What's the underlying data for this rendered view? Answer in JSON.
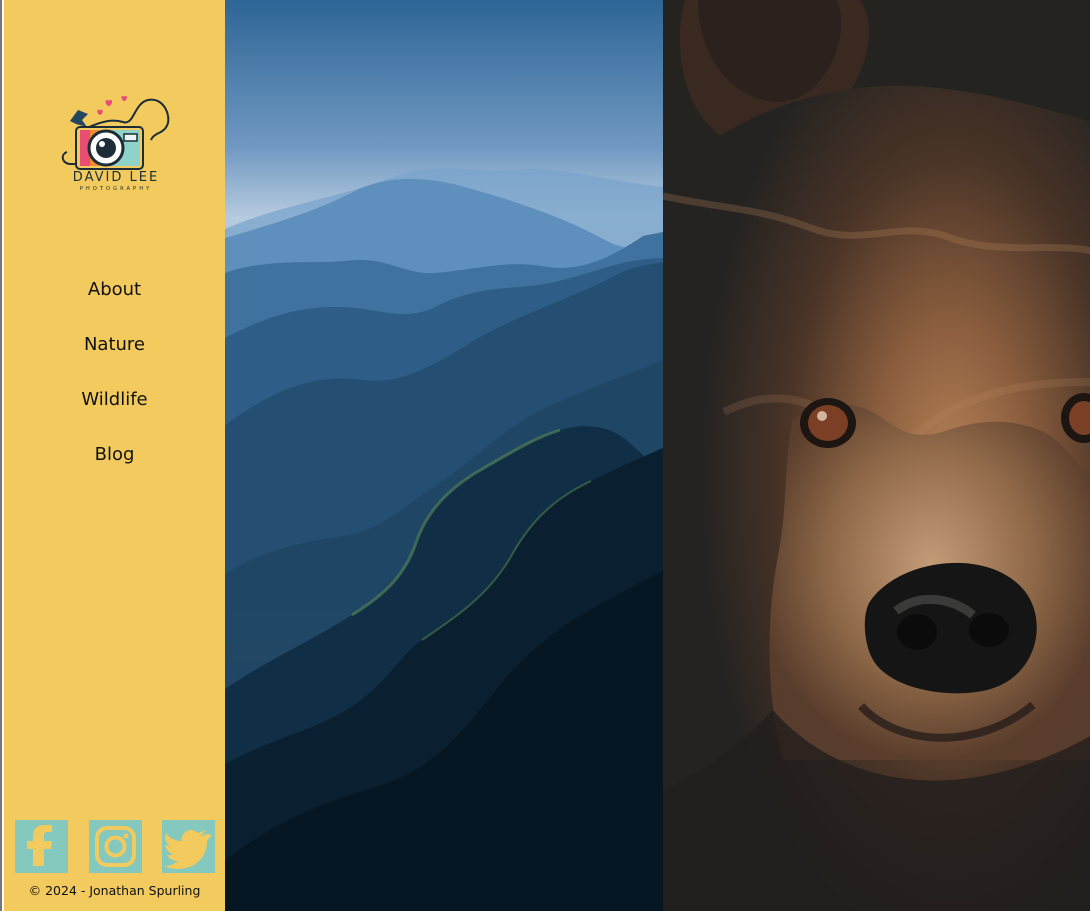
{
  "brand": {
    "name": "DAVID LEE",
    "tagline": "PHOTOGRAPHY"
  },
  "sidebar": {
    "nav": [
      {
        "label": "About"
      },
      {
        "label": "Nature"
      },
      {
        "label": "Wildlife"
      },
      {
        "label": "Blog"
      }
    ],
    "social": [
      {
        "name": "facebook",
        "icon": "facebook-icon"
      },
      {
        "name": "instagram",
        "icon": "instagram-icon"
      },
      {
        "name": "twitter",
        "icon": "twitter-icon"
      }
    ],
    "copyright": "© 2024 - Jonathan Spurling"
  },
  "colors": {
    "sidebar_background": "#f2ca5d",
    "social_tile": "#84c8be",
    "text": "#111111"
  },
  "panels": [
    {
      "name": "nature",
      "image": "blue mountain ridges"
    },
    {
      "name": "wildlife",
      "image": "brown bear close-up"
    }
  ]
}
